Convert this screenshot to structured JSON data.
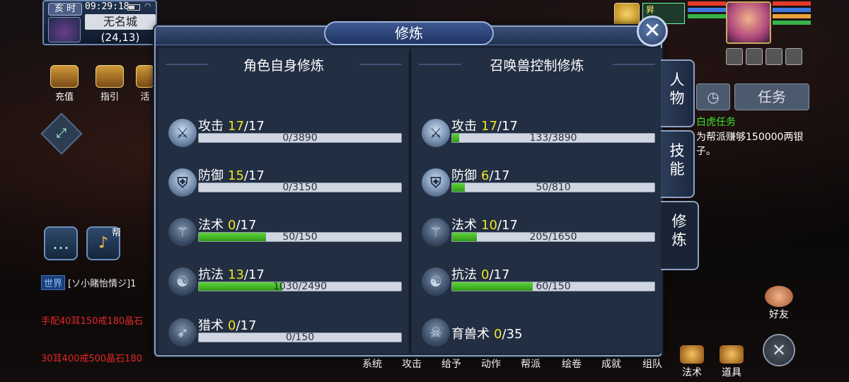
{
  "hud": {
    "hour_tag": "亥 时",
    "clock": "09:29:18",
    "map_name": "无名城",
    "coords": "(24,13)",
    "top_buttons": [
      "充值",
      "指引",
      "活"
    ],
    "voice_tag": "帮",
    "chat": [
      {
        "tag": "世界",
        "text": "[ソ小賭怡情ジ]1",
        "color": "white"
      },
      {
        "text": "手配40耳150戒180晶石",
        "color": "red"
      },
      {
        "text": "30耳400戒500晶石180",
        "color": "red"
      }
    ],
    "pet_label": "昇",
    "side_task_button": "任务",
    "task_title": "白虎任务",
    "task_desc": "为帮派赚够150000两银子。",
    "friend_label": "好友",
    "bottom_menu": [
      "系统",
      "攻击",
      "给予",
      "动作",
      "帮派",
      "绘卷",
      "成就",
      "组队",
      "法术",
      "道具"
    ]
  },
  "dialog": {
    "title": "修炼",
    "close_icon": "close-icon",
    "left": {
      "header": "角色自身修炼",
      "rows": [
        {
          "name": "攻击",
          "level": "17",
          "max": "/17",
          "progress": "0/3890",
          "fraction": 0,
          "icon": "sword-icon"
        },
        {
          "name": "防御",
          "level": "15",
          "max": "/17",
          "progress": "0/3150",
          "fraction": 0,
          "icon": "shield-icon"
        },
        {
          "name": "法术",
          "level": "0",
          "max": "/17",
          "progress": "50/150",
          "fraction": 0.333,
          "icon": "staff-icon"
        },
        {
          "name": "抗法",
          "level": "13",
          "max": "/17",
          "progress": "1030/2490",
          "fraction": 0.414,
          "icon": "yin-yang-icon"
        },
        {
          "name": "猎术",
          "level": "0",
          "max": "/17",
          "progress": "0/150",
          "fraction": 0,
          "icon": "bow-icon"
        }
      ]
    },
    "right": {
      "header": "召唤兽控制修炼",
      "rows": [
        {
          "name": "攻击",
          "level": "17",
          "max": "/17",
          "progress": "133/3890",
          "fraction": 0.034,
          "icon": "sword-icon"
        },
        {
          "name": "防御",
          "level": "6",
          "max": "/17",
          "progress": "50/810",
          "fraction": 0.062,
          "icon": "shield-icon"
        },
        {
          "name": "法术",
          "level": "10",
          "max": "/17",
          "progress": "205/1650",
          "fraction": 0.124,
          "icon": "staff-icon"
        },
        {
          "name": "抗法",
          "level": "0",
          "max": "/17",
          "progress": "60/150",
          "fraction": 0.4,
          "icon": "yin-yang-icon"
        },
        {
          "name": "育兽术",
          "level": "0",
          "max": "/35",
          "icon": "beast-skull-icon"
        }
      ]
    },
    "tabs": [
      {
        "label": "人\n物",
        "active": false
      },
      {
        "label": "技\n能",
        "active": false
      },
      {
        "label": "修\n炼",
        "active": true
      }
    ]
  },
  "colors": {
    "level_highlight": "#f1e424",
    "bar_fill": "#4cc22a",
    "bar_bg": "#cfd6e2",
    "dialog_bg": "#1a2436"
  }
}
